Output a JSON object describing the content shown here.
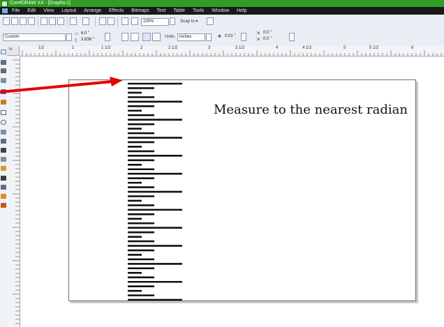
{
  "window": {
    "title": "CorelDRAW X4 - [Graphic1]"
  },
  "menu": [
    "File",
    "Edit",
    "View",
    "Layout",
    "Arrange",
    "Effects",
    "Bitmaps",
    "Text",
    "Table",
    "Tools",
    "Window",
    "Help"
  ],
  "toolbar": {
    "zoom": "100%",
    "snap_to": "Snap to"
  },
  "property_bar": {
    "paper_type": "Custom",
    "width": "6.0 \"",
    "height": "3.838 \"",
    "units_label": "Units:",
    "units": "inches",
    "nudge": "0.01 \"",
    "dup_x": "0.0 \"",
    "dup_y": "0.0 \""
  },
  "ruler": {
    "unit_label": "in",
    "h_labels": [
      "1/2",
      "1",
      "1 1/2",
      "2",
      "2 1/2",
      "3",
      "3 1/2",
      "4",
      "4 1/2",
      "5",
      "5 1/2",
      "6"
    ]
  },
  "document": {
    "caption": "Measure to the nearest radian"
  },
  "ticks": [
    3,
    2,
    1,
    2,
    3,
    2,
    1,
    2,
    3,
    2,
    1,
    2,
    3,
    2,
    1,
    2,
    3,
    2,
    1,
    2,
    3,
    2,
    1,
    2,
    3,
    2,
    1,
    2,
    3,
    2,
    1,
    2,
    3,
    2,
    1,
    2,
    3,
    2,
    1,
    2,
    3,
    2,
    1,
    2,
    3,
    2,
    1,
    2,
    3
  ],
  "colors": {
    "titlebar": "#2f9e22",
    "menubar": "#1a1a1a",
    "arrow": "#e60000"
  }
}
